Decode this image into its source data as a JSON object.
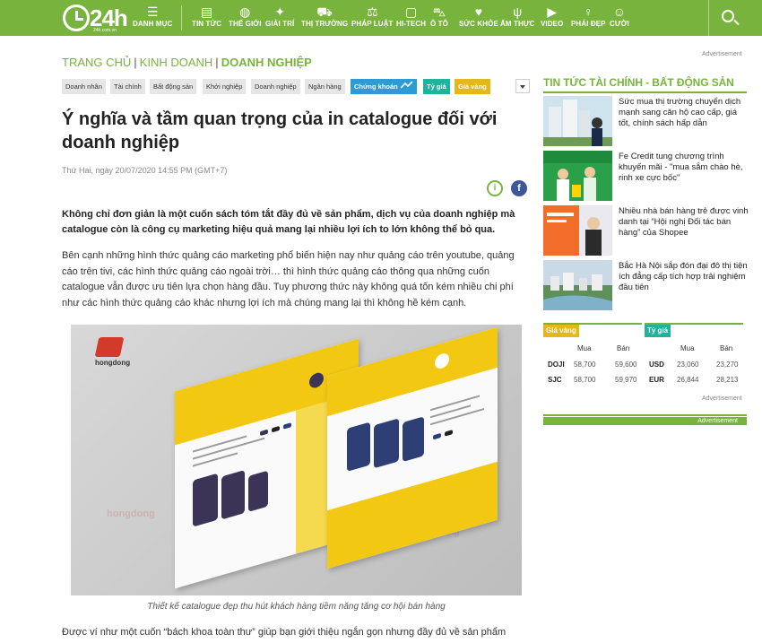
{
  "header": {
    "logo_text": "24h",
    "logo_sub": "24h.com.vn",
    "nav": [
      {
        "icon": "☰",
        "label": "DANH MỤC",
        "icon_name": "menu-icon"
      },
      {
        "icon": "▤",
        "label": "TIN TỨC",
        "icon_name": "newspaper-icon"
      },
      {
        "icon": "◍",
        "label": "THẾ GIỚI",
        "icon_name": "globe-icon"
      },
      {
        "icon": "✦",
        "label": "GIẢI TRÍ",
        "icon_name": "entertainment-icon"
      },
      {
        "icon": "⛟",
        "label": "THỊ TRƯỜNG",
        "icon_name": "cart-icon"
      },
      {
        "icon": "⚖",
        "label": "PHÁP LUẬT",
        "icon_name": "scales-icon"
      },
      {
        "icon": "▢",
        "label": "HI-TECH",
        "icon_name": "phone-icon"
      },
      {
        "icon": "⛍",
        "label": "Ô TÔ",
        "icon_name": "car-icon"
      },
      {
        "icon": "♥",
        "label": "SỨC KHỎE",
        "icon_name": "heart-icon"
      },
      {
        "icon": "ψ",
        "label": "ẨM THỰC",
        "icon_name": "cutlery-icon"
      },
      {
        "icon": "▶",
        "label": "VIDEO",
        "icon_name": "video-icon"
      },
      {
        "icon": "♀",
        "label": "PHÁI ĐẸP",
        "icon_name": "woman-icon"
      },
      {
        "icon": "☺",
        "label": "CƯỜI",
        "icon_name": "smile-icon"
      }
    ]
  },
  "ads": {
    "label": "Advertisement",
    "bar": "Advertisement"
  },
  "breadcrumb": [
    "TRANG CHỦ",
    "KINH DOANH",
    "DOANH NGHIỆP"
  ],
  "categories": [
    {
      "label": "Doanh nhân",
      "style": "plain"
    },
    {
      "label": "Tài chính",
      "style": "plain"
    },
    {
      "label": "Bất động sản",
      "style": "plain"
    },
    {
      "label": "Khởi nghiệp",
      "style": "plain"
    },
    {
      "label": "Doanh nghiệp",
      "style": "plain"
    },
    {
      "label": "Ngân hàng",
      "style": "plain"
    },
    {
      "label": "Chứng khoán",
      "style": "blue"
    },
    {
      "label": "Tỷ giá",
      "style": "teal"
    },
    {
      "label": "Giá vàng",
      "style": "gold"
    }
  ],
  "article": {
    "title": "Ý nghĩa và tầm quan trọng của in catalogue đối với doanh nghiệp",
    "date": "Thứ Hai, ngày 20/07/2020 14:55 PM (GMT+7)",
    "lead": "Không chỉ đơn giản là một cuốn sách tóm tắt đầy đủ về sản phẩm, dịch vụ của doanh nghiệp mà catalogue còn là công cụ marketing hiệu quả mang lại nhiều lợi ích to lớn không thể bỏ qua.",
    "p1": "Bên cạnh những hình thức quảng cáo marketing phổ biến hiện nay như quảng cáo trên youtube, quảng cáo trên tivi, các hình thức quảng cáo ngoài trời… thì hình thức quảng cáo thông qua những cuốn catalogue vẫn được ưu tiên lựa chọn hàng đầu. Tuy phương thức này không quá tốn kém nhiều chi phí như các hình thức quảng cáo khác nhưng lợi ích mà chúng mang lại thì không hề kém cạnh.",
    "figure_brand": "hongdong",
    "caption": "Thiết kế catalogue đẹp thu hút khách hàng tiềm năng tăng cơ hội bán hàng",
    "p2": "Được ví như một cuốn “bách khoa toàn thư” giúp bạn giới thiệu ngắn gọn nhưng đầy đủ về sản phẩm"
  },
  "sidebar": {
    "title": "TIN TỨC TÀI CHÍNH - BẤT ĐỘNG SẢN",
    "news": [
      {
        "text": "Sức mua thị trường chuyển dịch mạnh sang căn hộ cao cấp, giá tốt, chính sách hấp dẫn"
      },
      {
        "text": "Fe Credit tung chương trình khuyến mãi - \"mua sắm chào hè, rinh xe cực bốc\""
      },
      {
        "text": "Nhiều nhà bán hàng trẻ được vinh danh tại “Hội nghị Đối tác bán hàng” của Shopee"
      },
      {
        "text": "Bắc Hà Nội sắp đón đại đô thị tiện ích đẳng cấp tích hợp trải nghiệm đầu tiên"
      }
    ],
    "gold": {
      "tag": "Giá vàng",
      "buy": "Mua",
      "sell": "Bán",
      "rows": [
        {
          "name": "DOJI",
          "buy": "58,700",
          "sell": "59,600"
        },
        {
          "name": "SJC",
          "buy": "58,700",
          "sell": "59,970"
        }
      ]
    },
    "fx": {
      "tag": "Tỷ giá",
      "buy": "Mua",
      "sell": "Bán",
      "rows": [
        {
          "name": "USD",
          "buy": "23,060",
          "sell": "23,270"
        },
        {
          "name": "EUR",
          "buy": "26,844",
          "sell": "28,213"
        }
      ]
    }
  },
  "colors": {
    "brand_green": "#78b43d",
    "stock_blue": "#2d9bd6",
    "fx_teal": "#1fb39c",
    "gold": "#e3b818"
  }
}
